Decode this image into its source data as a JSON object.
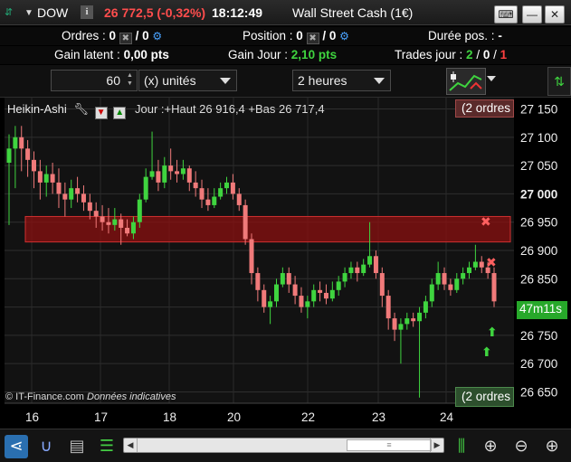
{
  "titlebar": {
    "symbol": "DOW",
    "info_label": "i",
    "price": "26 772,5 (-0,32%)",
    "time": "18:12:49",
    "market": "Wall Street Cash (1€)",
    "keyboard_icon": "keyboard-icon",
    "minimize_label": "—",
    "close_label": "✕"
  },
  "stats": {
    "orders_label": "Ordres :",
    "orders_a": "0",
    "orders_b": "/ 0",
    "position_label": "Position :",
    "position_a": "0",
    "position_b": "/ 0",
    "duration_label": "Durée pos. :",
    "duration_value": "-",
    "gain_latent_label": "Gain latent :",
    "gain_latent_value": "0,00 pts",
    "gain_jour_label": "Gain Jour :",
    "gain_jour_value": "2,10 pts",
    "trades_label": "Trades jour :",
    "trades_a": "2",
    "trades_sep1": " / ",
    "trades_b": "0",
    "trades_sep2": " / ",
    "trades_c": "1"
  },
  "toolbar": {
    "quantity": "60",
    "unit_select": "(x) unités",
    "timeframe_select": "2 heures"
  },
  "chart": {
    "indicator": "Heikin-Ashi",
    "jour_text": "Jour :+Haut 26 916,4 +Bas 26 717,4",
    "orders_top": "(2 ordres",
    "orders_bottom": "(2 ordres",
    "countdown": "47m11s",
    "credit": "© IT-Finance.com",
    "credit_note": "Données indicatives"
  },
  "chart_data": {
    "type": "candlestick",
    "y_ticks": [
      "27 150",
      "27 100",
      "27 050",
      "27 000",
      "26 950",
      "26 900",
      "26 850",
      "26 800",
      "26 750",
      "26 700",
      "26 650"
    ],
    "x_ticks": [
      "16",
      "17",
      "18",
      "20",
      "22",
      "23",
      "24"
    ],
    "ylim": [
      26630,
      27170
    ],
    "grid": true,
    "zone": {
      "from": 26930,
      "to": 26945
    },
    "colors": {
      "up": "#3fd43f",
      "down": "#f07a7a",
      "zone": "#8b1010"
    },
    "candles": [
      [
        27055,
        27080,
        27105,
        26945
      ],
      [
        27080,
        27100,
        27120,
        27010
      ],
      [
        27100,
        27080,
        27120,
        27040
      ],
      [
        27080,
        27060,
        27095,
        27030
      ],
      [
        27060,
        27040,
        27075,
        27010
      ],
      [
        27040,
        27020,
        27060,
        26990
      ],
      [
        27020,
        27035,
        27050,
        26995
      ],
      [
        27035,
        27020,
        27055,
        27000
      ],
      [
        27020,
        27000,
        27045,
        26975
      ],
      [
        27000,
        26990,
        27020,
        26960
      ],
      [
        26990,
        27010,
        27025,
        26975
      ],
      [
        27010,
        27000,
        27030,
        26985
      ],
      [
        27000,
        26985,
        27015,
        26970
      ],
      [
        26985,
        26970,
        27000,
        26955
      ],
      [
        26970,
        26960,
        26985,
        26940
      ],
      [
        26960,
        26950,
        26980,
        26935
      ],
      [
        26950,
        26945,
        26975,
        26930
      ],
      [
        26945,
        26955,
        26975,
        26935
      ],
      [
        26955,
        26940,
        26965,
        26910
      ],
      [
        26940,
        26930,
        26955,
        26925
      ],
      [
        26930,
        26950,
        26960,
        26920
      ],
      [
        26950,
        26990,
        27000,
        26940
      ],
      [
        26990,
        27030,
        27045,
        26985
      ],
      [
        27030,
        27040,
        27110,
        27025
      ],
      [
        27040,
        27020,
        27060,
        27005
      ],
      [
        27020,
        27050,
        27065,
        27010
      ],
      [
        27050,
        27040,
        27080,
        27025
      ],
      [
        27040,
        27035,
        27060,
        27020
      ],
      [
        27035,
        27045,
        27060,
        27025
      ],
      [
        27045,
        27020,
        27050,
        27005
      ],
      [
        27020,
        27010,
        27040,
        26995
      ],
      [
        27010,
        26990,
        27025,
        26975
      ],
      [
        26990,
        26980,
        27010,
        26970
      ],
      [
        26980,
        26995,
        27010,
        26975
      ],
      [
        26995,
        27010,
        27020,
        26990
      ],
      [
        27010,
        27020,
        27030,
        27000
      ],
      [
        27020,
        27000,
        27035,
        26990
      ],
      [
        27000,
        26980,
        27010,
        26970
      ],
      [
        26980,
        26920,
        26990,
        26910
      ],
      [
        26920,
        26860,
        26930,
        26840
      ],
      [
        26860,
        26830,
        26870,
        26810
      ],
      [
        26830,
        26800,
        26840,
        26790
      ],
      [
        26800,
        26810,
        26820,
        26770
      ],
      [
        26810,
        26840,
        26850,
        26800
      ],
      [
        26840,
        26860,
        26870,
        26835
      ],
      [
        26860,
        26840,
        26870,
        26825
      ],
      [
        26840,
        26820,
        26855,
        26805
      ],
      [
        26820,
        26800,
        26835,
        26790
      ],
      [
        26800,
        26810,
        26820,
        26780
      ],
      [
        26810,
        26830,
        26840,
        26800
      ],
      [
        26830,
        26825,
        26845,
        26810
      ],
      [
        26825,
        26815,
        26840,
        26805
      ],
      [
        26815,
        26830,
        26845,
        26810
      ],
      [
        26830,
        26845,
        26855,
        26820
      ],
      [
        26845,
        26860,
        26870,
        26835
      ],
      [
        26860,
        26870,
        26880,
        26850
      ],
      [
        26870,
        26860,
        26880,
        26845
      ],
      [
        26860,
        26875,
        26885,
        26855
      ],
      [
        26875,
        26890,
        26950,
        26870
      ],
      [
        26890,
        26860,
        26900,
        26850
      ],
      [
        26860,
        26820,
        26870,
        26800
      ],
      [
        26820,
        26780,
        26830,
        26760
      ],
      [
        26780,
        26760,
        26790,
        26740
      ],
      [
        26760,
        26770,
        26780,
        26700
      ],
      [
        26770,
        26780,
        26790,
        26760
      ],
      [
        26780,
        26775,
        26790,
        26765
      ],
      [
        26775,
        26790,
        26800,
        26640
      ],
      [
        26790,
        26810,
        26820,
        26780
      ],
      [
        26810,
        26840,
        26850,
        26800
      ],
      [
        26840,
        26860,
        26880,
        26830
      ],
      [
        26860,
        26840,
        26870,
        26830
      ],
      [
        26840,
        26830,
        26850,
        26820
      ],
      [
        26830,
        26850,
        26860,
        26825
      ],
      [
        26850,
        26860,
        26870,
        26840
      ],
      [
        26860,
        26870,
        26880,
        26850
      ],
      [
        26870,
        26880,
        26910,
        26865
      ],
      [
        26880,
        26870,
        26890,
        26860
      ],
      [
        26870,
        26860,
        26880,
        26850
      ],
      [
        26860,
        26810,
        26870,
        26800
      ]
    ]
  },
  "bottombar": {
    "icons": [
      "share-icon",
      "magnet-icon",
      "layout-icon",
      "color-bars-icon",
      "candle-icon",
      "zoom-fit-icon",
      "zoom-out-icon",
      "zoom-in-icon"
    ]
  }
}
